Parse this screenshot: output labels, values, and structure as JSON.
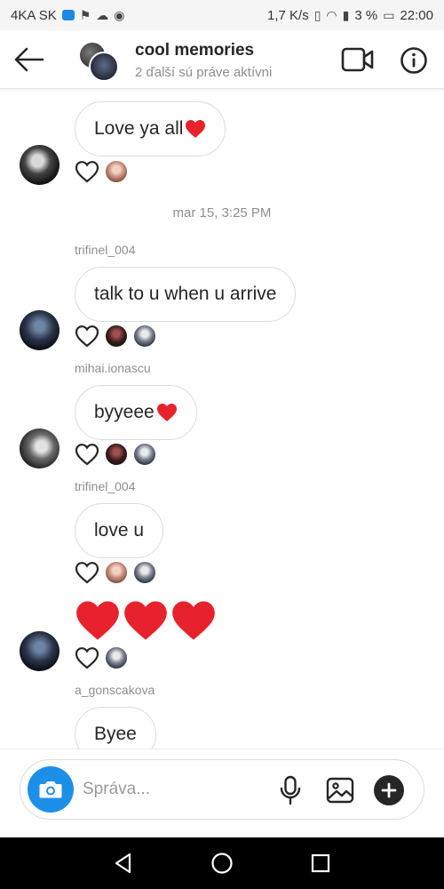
{
  "status_bar": {
    "carrier": "4KA SK",
    "speed": "1,7 K/s",
    "battery": "3 %",
    "time": "22:00"
  },
  "header": {
    "title": "cool memories",
    "subtitle": "2 ďalší sú práve aktívni"
  },
  "messages": {
    "m1": {
      "text": "Love ya all"
    },
    "timestamp": "mar 15, 3:25 PM",
    "m2": {
      "sender": "trifinel_004",
      "text": "talk to u when u arrive"
    },
    "m3": {
      "sender": "mihai.ionascu",
      "text": "byyeee"
    },
    "m4": {
      "sender": "trifinel_004",
      "text": "love u"
    },
    "m6": {
      "sender": "a_gonscakova",
      "text": "Byee"
    }
  },
  "composer": {
    "placeholder": "Správa..."
  },
  "colors": {
    "accent_blue": "#1e8fe8",
    "heart_red": "#e8222c",
    "secondary_text": "#8e8e8e"
  }
}
